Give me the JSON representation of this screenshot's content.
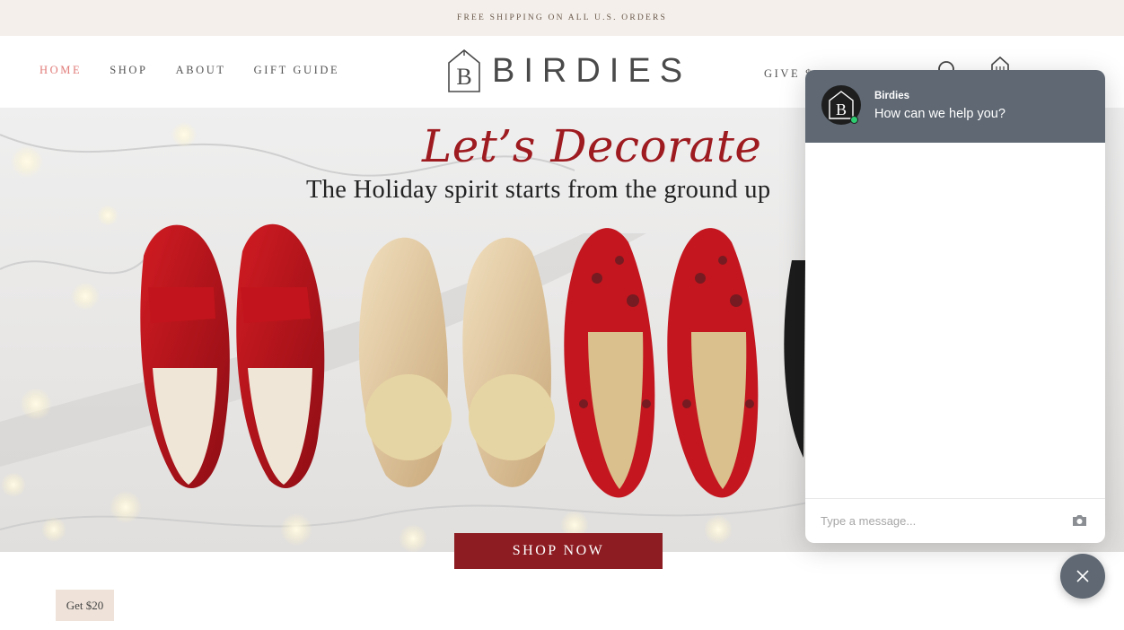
{
  "announcement": {
    "text": "FREE SHIPPING ON ALL U.S. ORDERS"
  },
  "nav": {
    "items": [
      {
        "label": "HOME",
        "active": true
      },
      {
        "label": "SHOP",
        "active": false
      },
      {
        "label": "ABOUT",
        "active": false
      },
      {
        "label": "GIFT GUIDE",
        "active": false
      }
    ]
  },
  "brand": {
    "name": "BIRDIES",
    "monogram": "B"
  },
  "header": {
    "give_label": "GIVE $",
    "icons": [
      "search-icon",
      "cart-icon"
    ]
  },
  "hero": {
    "script_title": "Let’s Decorate",
    "subtitle": "The Holiday spirit starts from the ground up",
    "cta": "SHOP NOW"
  },
  "promo": {
    "label": "Get $20"
  },
  "chat": {
    "agent_name": "Birdies",
    "greeting": "How can we help you?",
    "input_placeholder": "Type a message...",
    "status": "online",
    "icons": [
      "camera-icon",
      "close-icon"
    ]
  },
  "colors": {
    "accent_red": "#8c1c22",
    "nav_active": "#e07a77",
    "chat_header": "#5f6873",
    "announcement_bg": "#f4efea",
    "online": "#2ecc71"
  }
}
